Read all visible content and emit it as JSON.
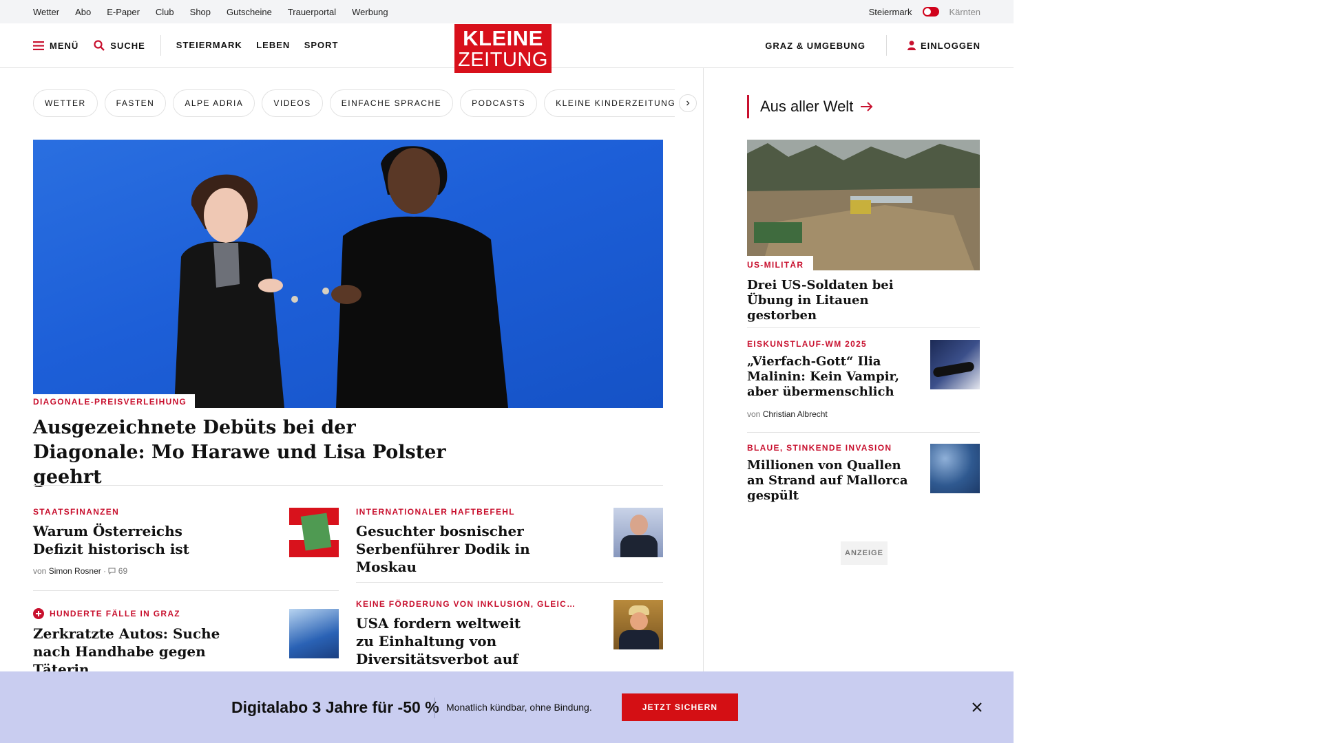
{
  "utility_bar": {
    "links": [
      "Wetter",
      "Abo",
      "E-Paper",
      "Club",
      "Shop",
      "Gutscheine",
      "Trauerportal",
      "Werbung"
    ],
    "region_active": "Steiermark",
    "region_inactive": "Kärnten"
  },
  "header": {
    "menu_label": "MENÜ",
    "search_label": "SUCHE",
    "nav": [
      "STEIERMARK",
      "LEBEN",
      "SPORT"
    ],
    "logo_line1": "KLEINE",
    "logo_line2": "ZEITUNG",
    "local_label": "GRAZ & UMGEBUNG",
    "login_label": "EINLOGGEN"
  },
  "topic_pills": [
    "WETTER",
    "FASTEN",
    "ALPE ADRIA",
    "VIDEOS",
    "EINFACHE SPRACHE",
    "PODCASTS",
    "KLEINE KINDERZEITUNG"
  ],
  "hero": {
    "kicker": "DIAGONALE-PREISVERLEIHUNG",
    "title": "Ausgezeichnete Debüts bei der Diagonale: Mo Harawe und Lisa Polster geehrt"
  },
  "stories": [
    {
      "kicker": "STAATSFINANZEN",
      "title": "Warum Österreichs Defizit historisch ist",
      "by": "von",
      "author": "Simon Rosner",
      "comments": "69"
    },
    {
      "kicker": "INTERNATIONALER HAFTBEFEHL",
      "title": "Gesuchter bosnischer Serbenführer Dodik in Moskau"
    },
    {
      "kicker": "HUNDERTE FÄLLE IN GRAZ",
      "title": "Zerkratzte Autos: Suche nach Handhabe gegen Täterin"
    },
    {
      "kicker": "KEINE FÖRDERUNG VON INKLUSION, GLEIC…",
      "title": "USA fordern weltweit zu Einhaltung von Diversitätsverbot auf"
    }
  ],
  "sidebar": {
    "section_title": "Aus aller Welt",
    "lead": {
      "kicker": "US-MILITÄR",
      "title": "Drei US-Soldaten bei Übung in Litauen gestorben"
    },
    "items": [
      {
        "kicker": "EISKUNSTLAUF-WM 2025",
        "title": "„Vierfach-Gott“ Ilia Malinin: Kein Vampir, aber übermenschlich",
        "by": "von",
        "author": "Christian Albrecht"
      },
      {
        "kicker": "BLAUE, STINKENDE INVASION",
        "title": "Millionen von Quallen an Strand auf Mallorca gespült"
      }
    ],
    "ad_label": "ANZEIGE"
  },
  "promo": {
    "headline": "Digitalabo 3 Jahre für -50 %",
    "subline": "Monatlich kündbar, ohne Bindung.",
    "cta": "JETZT SICHERN"
  }
}
